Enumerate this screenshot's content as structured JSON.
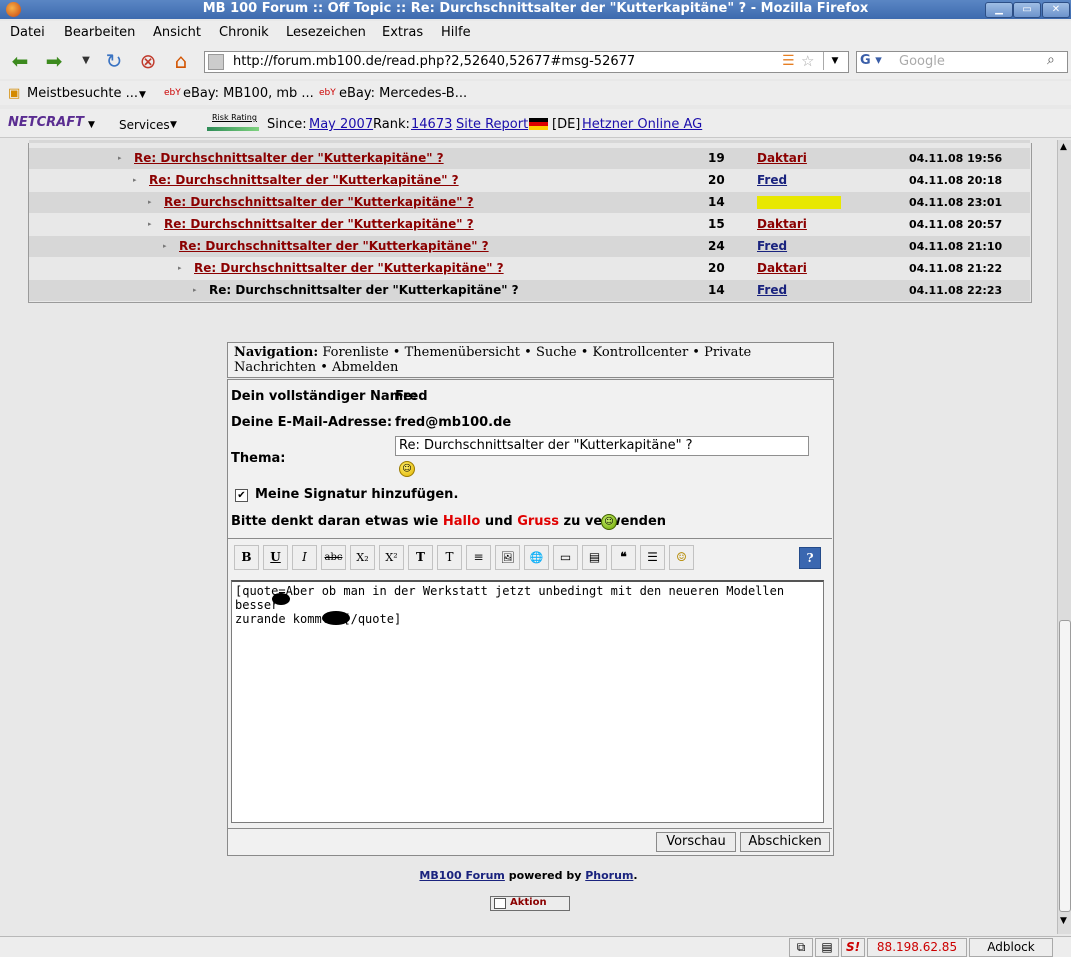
{
  "window": {
    "title": "MB 100 Forum :: Off Topic :: Re: Durchschnittsalter der \"Kutterkapitäne\" ? - Mozilla Firefox",
    "min": "▁",
    "max": "▭",
    "close": "✕"
  },
  "menu": [
    "Datei",
    "Bearbeiten",
    "Ansicht",
    "Chronik",
    "Lesezeichen",
    "Extras",
    "Hilfe"
  ],
  "nav": {
    "url": "http://forum.mb100.de/read.php?2,52640,52677#msg-52677",
    "search_placeholder": "Google"
  },
  "bookmarks": [
    "Meistbesuchte ...",
    "eBay: MB100, mb ...",
    "eBay: Mercedes-B..."
  ],
  "netcraft": {
    "logo": "NETCRAFT",
    "services": "Services",
    "risk": "Risk Rating",
    "since_label": "Since:",
    "since_value": "May 2007",
    "rank_label": "Rank:",
    "rank_value": "14673",
    "site_report": "Site Report",
    "country": "[DE]",
    "host": "Hetzner Online AG"
  },
  "thread": [
    {
      "subject": "Re: Durchschnittsalter der \"Kutterkapitäne\" ?",
      "count": "19",
      "author": "Daktari",
      "date": "04.11.08 19:56",
      "author_color": "#8b0000"
    },
    {
      "subject": "Re: Durchschnittsalter der \"Kutterkapitäne\" ?",
      "count": "20",
      "author": "Fred",
      "date": "04.11.08 20:18",
      "author_color": "#1a237e"
    },
    {
      "subject": "Re: Durchschnittsalter der \"Kutterkapitäne\" ?",
      "count": "14",
      "author": "",
      "date": "04.11.08 23:01",
      "author_color": "#e0e000"
    },
    {
      "subject": "Re: Durchschnittsalter der \"Kutterkapitäne\" ?",
      "count": "15",
      "author": "Daktari",
      "date": "04.11.08 20:57",
      "author_color": "#8b0000"
    },
    {
      "subject": "Re: Durchschnittsalter der \"Kutterkapitäne\" ?",
      "count": "24",
      "author": "Fred",
      "date": "04.11.08 21:10",
      "author_color": "#1a237e"
    },
    {
      "subject": "Re: Durchschnittsalter der \"Kutterkapitäne\" ?",
      "count": "20",
      "author": "Daktari",
      "date": "04.11.08 21:22",
      "author_color": "#8b0000"
    },
    {
      "subject": "Re: Durchschnittsalter der \"Kutterkapitäne\" ?",
      "count": "14",
      "author": "Fred",
      "date": "04.11.08 22:23",
      "author_color": "#1a237e"
    }
  ],
  "navigation": {
    "label": "Navigation:",
    "links": [
      "Forenliste",
      "Themenübersicht",
      "Suche",
      "Kontrollcenter",
      "Private Nachrichten",
      "Abmelden"
    ]
  },
  "form": {
    "name_label": "Dein vollständiger Name:",
    "name_value": "Fred",
    "email_label": "Deine E-Mail-Adresse:",
    "email_value": "fred@mb100.de",
    "subject_label": "Thema:",
    "subject_value": "Re: Durchschnittsalter der \"Kutterkapitäne\" ?",
    "signature_label": "Meine Signatur hinzufügen.",
    "signature_checked": "✔",
    "reminder_pre": "Bitte denkt daran etwas wie ",
    "reminder_hallo": "Hallo",
    "reminder_und": " und ",
    "reminder_gruss": "Gruss",
    "reminder_post": " zu verwenden",
    "body": "[quote=Aber ob man in der Werkstatt jetzt unbedingt mit den neueren Modellen besser\nzurande kommt?][/quote]",
    "preview": "Vorschau",
    "submit": "Abschicken"
  },
  "toolbar_icons": [
    "B",
    "U",
    "I",
    "abc",
    "X₂",
    "X²",
    "T",
    "T",
    "≡",
    "🖼",
    "🌐",
    "▭",
    "▤",
    "❝",
    "☰",
    "☺"
  ],
  "help": "?",
  "footer": {
    "site": "MB100 Forum",
    "powered": " powered by ",
    "phorum": "Phorum",
    "dot": "."
  },
  "aktion": "Aktion",
  "status": {
    "ip": "88.198.62.85",
    "adblock": "Adblock"
  }
}
